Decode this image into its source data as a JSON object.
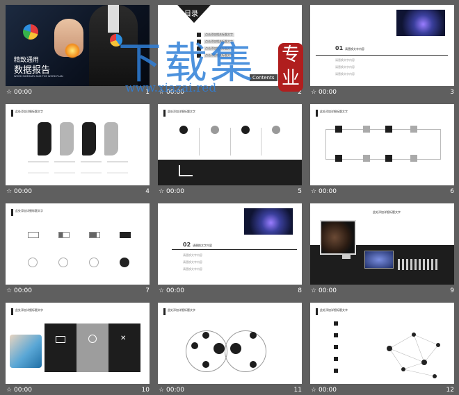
{
  "slides": [
    {
      "number": "1",
      "time": "00:00",
      "title_cn": "精致通用",
      "subtitle_cn": "数据报告",
      "caption": "WORK SUMMARY AND THE WORK PLAN"
    },
    {
      "number": "2",
      "time": "00:00",
      "toc_title": "目录",
      "contents": "Contents",
      "toc_items": [
        "点击添加相关标题文字",
        "点击添加相关标题文字",
        "点击添加相关标题文字",
        "点击添加相关标题文字"
      ]
    },
    {
      "number": "3",
      "time": "00:00",
      "section": "01",
      "section_title": "请替换文字内容",
      "lines": [
        "请替换文字内容",
        "请替换文字内容",
        "请替换文字内容"
      ]
    },
    {
      "number": "4",
      "time": "00:00",
      "header": "此处添加详细标题文字"
    },
    {
      "number": "5",
      "time": "00:00",
      "header": "此处添加详细标题文字"
    },
    {
      "number": "6",
      "time": "00:00",
      "header": "此处添加详细标题文字"
    },
    {
      "number": "7",
      "time": "00:00",
      "header": "此处添加详细标题文字"
    },
    {
      "number": "8",
      "time": "00:00",
      "section": "02",
      "section_title": "请替换文字内容",
      "lines": [
        "请替换文字内容",
        "请替换文字内容",
        "请替换文字内容"
      ]
    },
    {
      "number": "9",
      "time": "00:00",
      "header": "此处添加详细标题文字"
    },
    {
      "number": "10",
      "time": "00:00",
      "header": "此处添加详细标题文字"
    },
    {
      "number": "11",
      "time": "00:00",
      "header": "此处添加详细标题文字"
    },
    {
      "number": "12",
      "time": "00:00",
      "header": "此处添加详细标题文字"
    }
  ],
  "watermark": {
    "main": "下载集",
    "url": "www.xiazai.red",
    "seal": "专业"
  },
  "icons": {
    "star": "☆",
    "play": "▶"
  },
  "colors": {
    "background": "#5f5f5f",
    "dark": "#1d1d1d",
    "watermark": "#2f7fd8",
    "seal": "#b01e1e"
  }
}
